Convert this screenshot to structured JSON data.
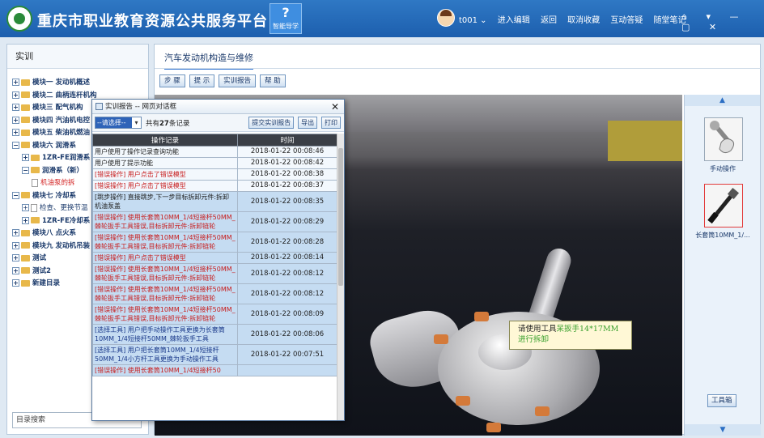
{
  "header": {
    "site_title": "重庆市职业教育资源公共服务平台",
    "guide_label": "智能导学",
    "user": "t001 ⌄",
    "links": [
      "进入编辑",
      "返回",
      "取消收藏",
      "互动答疑",
      "随堂笔记"
    ],
    "window_controls": "⌂ ▾ — ▢ ✕"
  },
  "sidebar": {
    "title": "实训",
    "items": [
      {
        "label": "模块一 发动机概述",
        "level": 0
      },
      {
        "label": "模块二 曲柄连杆机构",
        "level": 0
      },
      {
        "label": "模块三 配气机构",
        "level": 0
      },
      {
        "label": "模块四 汽油机电控",
        "level": 0
      },
      {
        "label": "模块五 柴油机燃油",
        "level": 0
      },
      {
        "label": "模块六 润滑系",
        "level": 0,
        "expanded": true
      },
      {
        "label": "1ZR-FE润滑系",
        "level": 1
      },
      {
        "label": "润滑系（新）",
        "level": 1,
        "expanded": true
      },
      {
        "label": "机油泵的拆",
        "level": 2,
        "active": true
      },
      {
        "label": "模块七 冷却系",
        "level": 0,
        "expanded": true
      },
      {
        "label": "检查、更换节温",
        "level": 1
      },
      {
        "label": "1ZR-FE冷却系",
        "level": 1
      },
      {
        "label": "模块八 点火系",
        "level": 0
      },
      {
        "label": "模块九 发动机吊装",
        "level": 0
      },
      {
        "label": "测试",
        "level": 0
      },
      {
        "label": "测试2",
        "level": 0
      },
      {
        "label": "新建目录",
        "level": 0
      }
    ],
    "search_placeholder": "目录搜索"
  },
  "main": {
    "tab_title": "汽车发动机构造与维修",
    "toolbar": [
      "步 骤",
      "提 示",
      "实训报告",
      "帮 助"
    ],
    "tooltip": {
      "line1_prefix": "请使用工具",
      "tool_name": "呆扳手14*17MM",
      "line2": "进行拆卸"
    },
    "tools": [
      {
        "label": "手动操作",
        "selected": false
      },
      {
        "label": "长套筒10MM_1/...",
        "selected": true
      }
    ],
    "toolbox_label": "工具箱",
    "rail_up": "▲",
    "rail_down": "▼"
  },
  "dialog": {
    "title": "实训报告 -- 网页对话框",
    "close": "✕",
    "select_value": "--请选择--",
    "count_prefix": "共有",
    "count_value": "27",
    "count_suffix": "条记录",
    "buttons": [
      "提交实训报告",
      "导出",
      "打印"
    ],
    "columns": [
      "操作记录",
      "时间"
    ],
    "rows": [
      {
        "op": "用户使用了操作记录查询功能",
        "time": "2018-01-22 00:08:46",
        "kind": "normal"
      },
      {
        "op": "用户使用了提示功能",
        "time": "2018-01-22 00:08:42",
        "kind": "normal"
      },
      {
        "op": "[错误操作] 用户点击了错误模型",
        "time": "2018-01-22 00:08:38",
        "kind": "err"
      },
      {
        "op": "[错误操作] 用户点击了错误模型",
        "time": "2018-01-22 00:08:37",
        "kind": "err"
      },
      {
        "op": "[跳步操作] 直接跳步,下一步目标拆卸元件:拆卸机油泵盖",
        "time": "2018-01-22 00:08:35",
        "kind": "normal"
      },
      {
        "op": "[错误操作] 使用长套筒10MM_1/4短接杆50MM_棘轮扳手工具错误,目标拆卸元件:拆卸链轮",
        "time": "2018-01-22 00:08:29",
        "kind": "err"
      },
      {
        "op": "[错误操作] 使用长套筒10MM_1/4短接杆50MM_棘轮扳手工具错误,目标拆卸元件:拆卸链轮",
        "time": "2018-01-22 00:08:28",
        "kind": "err"
      },
      {
        "op": "[错误操作] 用户点击了错误模型",
        "time": "2018-01-22 00:08:14",
        "kind": "err"
      },
      {
        "op": "[错误操作] 使用长套筒10MM_1/4短接杆50MM_棘轮扳手工具错误,目标拆卸元件:拆卸链轮",
        "time": "2018-01-22 00:08:12",
        "kind": "err"
      },
      {
        "op": "[错误操作] 使用长套筒10MM_1/4短接杆50MM_棘轮扳手工具错误,目标拆卸元件:拆卸链轮",
        "time": "2018-01-22 00:08:12",
        "kind": "err"
      },
      {
        "op": "[错误操作] 使用长套筒10MM_1/4短接杆50MM_棘轮扳手工具错误,目标拆卸元件:拆卸链轮",
        "time": "2018-01-22 00:08:09",
        "kind": "err"
      },
      {
        "op": "[选择工具] 用户把手动操作工具更换为长套筒10MM_1/4短接杆50MM_棘轮扳手工具",
        "time": "2018-01-22 00:08:06",
        "kind": "sel"
      },
      {
        "op": "[选择工具] 用户把长套筒10MM_1/4短接杆50MM_1/4小方杆工具更换为手动操作工具",
        "time": "2018-01-22 00:07:51",
        "kind": "sel"
      },
      {
        "op": "[错误操作] 使用长套筒10MM_1/4短接杆50",
        "time": "",
        "kind": "err"
      }
    ]
  }
}
